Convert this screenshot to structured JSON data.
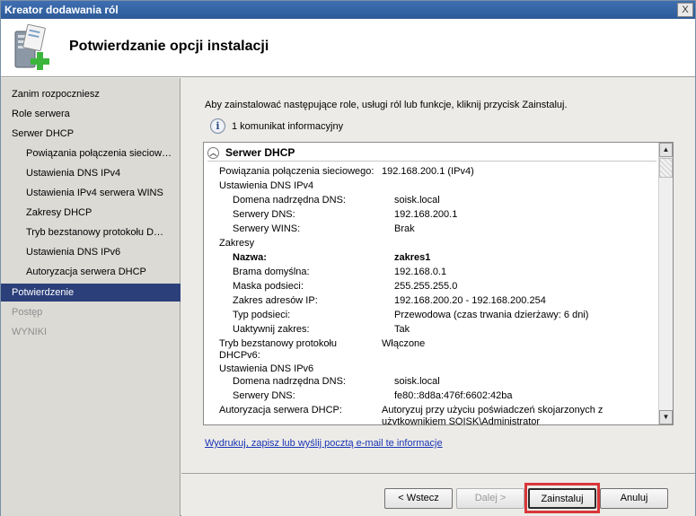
{
  "window": {
    "title": "Kreator dodawania ról",
    "close_glyph": "X"
  },
  "header": {
    "title": "Potwierdzanie opcji instalacji",
    "icon": "server-add-icon"
  },
  "sidebar": {
    "items": [
      {
        "label": "Zanim rozpoczniesz",
        "state": "normal"
      },
      {
        "label": "Role serwera",
        "state": "normal"
      },
      {
        "label": "Serwer DHCP",
        "state": "normal"
      },
      {
        "label": "Powiązania połączenia sieciow…",
        "state": "normal"
      },
      {
        "label": "Ustawienia DNS IPv4",
        "state": "normal"
      },
      {
        "label": "Ustawienia IPv4 serwera WINS",
        "state": "normal"
      },
      {
        "label": "Zakresy DHCP",
        "state": "normal"
      },
      {
        "label": "Tryb bezstanowy protokołu D…",
        "state": "normal"
      },
      {
        "label": "Ustawienia DNS IPv6",
        "state": "normal"
      },
      {
        "label": "Autoryzacja serwera DHCP",
        "state": "normal"
      },
      {
        "label": "Potwierdzenie",
        "state": "active"
      },
      {
        "label": "Postęp",
        "state": "disabled"
      },
      {
        "label": "WYNIKI",
        "state": "disabled"
      }
    ]
  },
  "main": {
    "intro": "Aby zainstalować następujące role, usługi ról lub funkcje, kliknij przycisk Zainstaluj.",
    "info_message": "1 komunikat informacyjny",
    "section_title": "Serwer DHCP",
    "details": {
      "bindings_label": "Powiązania połączenia sieciowego:",
      "bindings_value": "192.168.200.1 (IPv4)",
      "dns4_heading": "Ustawienia DNS IPv4",
      "dns4_domain_label": "Domena nadrzędna DNS:",
      "dns4_domain_value": "soisk.local",
      "dns4_servers_label": "Serwery DNS:",
      "dns4_servers_value": "192.168.200.1",
      "wins_label": "Serwery WINS:",
      "wins_value": "Brak",
      "scopes_heading": "Zakresy",
      "name_label": "Nazwa:",
      "name_value": "zakres1",
      "gateway_label": "Brama domyślna:",
      "gateway_value": "192.168.0.1",
      "mask_label": "Maska podsieci:",
      "mask_value": "255.255.255.0",
      "range_label": "Zakres adresów IP:",
      "range_value": "192.168.200.20 - 192.168.200.254",
      "subnet_type_label": "Typ podsieci:",
      "subnet_type_value": "Przewodowa (czas trwania dzierżawy: 6 dni)",
      "activate_label": "Uaktywnij zakres:",
      "activate_value": "Tak",
      "stateless_label_1": "Tryb bezstanowy protokołu",
      "stateless_label_2": "DHCPv6:",
      "stateless_value": "Włączone",
      "dns6_heading": "Ustawienia DNS IPv6",
      "dns6_domain_label": "Domena nadrzędna DNS:",
      "dns6_domain_value": "soisk.local",
      "dns6_servers_label": "Serwery DNS:",
      "dns6_servers_value": "fe80::8d8a:476f:6602:42ba",
      "auth_label": "Autoryzacja serwera DHCP:",
      "auth_value_1": "Autoryzuj przy użyciu poświadczeń skojarzonych z",
      "auth_value_2": "użytkownikiem SOISK\\Administrator"
    },
    "link": "Wydrukuj, zapisz lub wyślij pocztą e-mail te informacje"
  },
  "buttons": {
    "back": "< Wstecz",
    "next": "Dalej >",
    "install": "Zainstaluj",
    "cancel": "Anuluj"
  },
  "colors": {
    "highlight": "#d8363a",
    "active_nav": "#2b3f7a",
    "link": "#1a35b5"
  }
}
